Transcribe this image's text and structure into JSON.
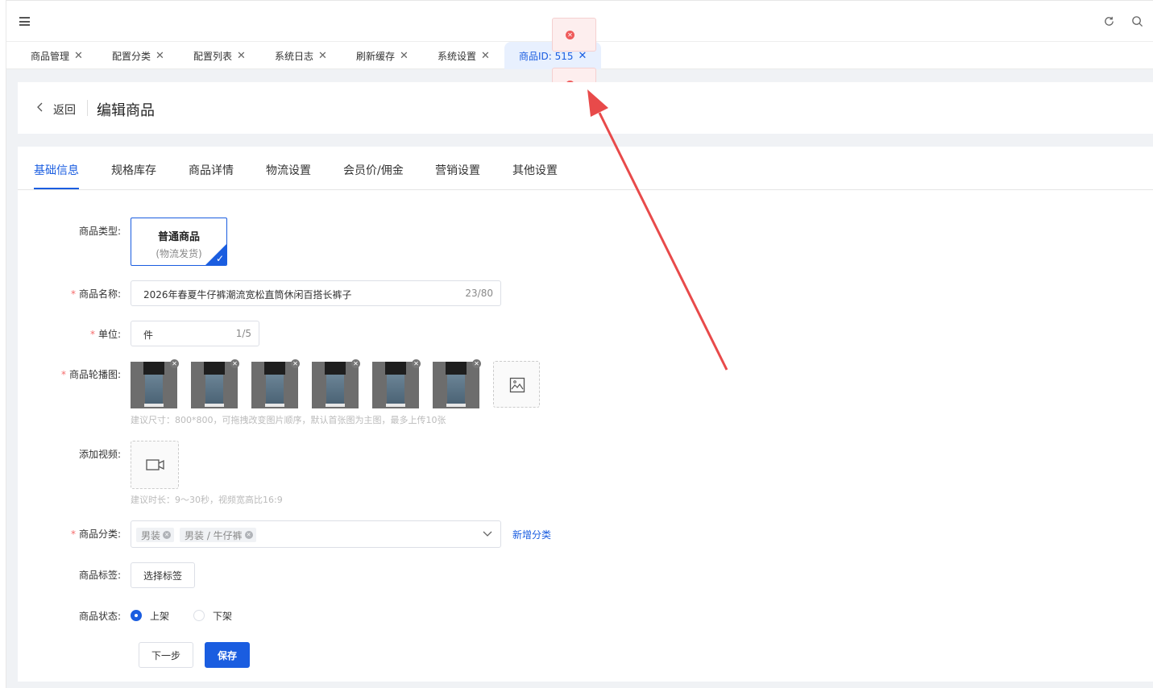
{
  "tabs": [
    {
      "label": "商品管理"
    },
    {
      "label": "配置分类"
    },
    {
      "label": "配置列表"
    },
    {
      "label": "系统日志"
    },
    {
      "label": "刷新缓存"
    },
    {
      "label": "系统设置"
    },
    {
      "label": "商品ID: 515"
    }
  ],
  "header": {
    "back_label": "返回",
    "title": "编辑商品"
  },
  "subtabs": [
    "基础信息",
    "规格库存",
    "商品详情",
    "物流设置",
    "会员价/佣金",
    "营销设置",
    "其他设置"
  ],
  "form": {
    "type_label": "商品类型:",
    "type_option_title": "普通商品",
    "type_option_sub": "(物流发货)",
    "name_label": "商品名称:",
    "name_value": "2026年春夏牛仔裤潮流宽松直筒休闲百搭长裤子",
    "name_count": "23/80",
    "unit_label": "单位:",
    "unit_value": "件",
    "unit_count": "1/5",
    "carousel_label": "商品轮播图:",
    "carousel_hint": "建议尺寸：800*800，可拖拽改变图片顺序，默认首张图为主图，最多上传10张",
    "video_label": "添加视频:",
    "video_hint": "建议时长：9～30秒，视频宽高比16:9",
    "category_label": "商品分类:",
    "category_tags": [
      "男装",
      "男装 / 牛仔裤"
    ],
    "add_category": "新增分类",
    "tag_label": "商品标签:",
    "choose_tag": "选择标签",
    "status_label": "商品状态:",
    "status_on": "上架",
    "status_off": "下架",
    "next_btn": "下一步",
    "save_btn": "保存"
  },
  "colors": {
    "primary": "#1a5de0",
    "error": "#ef5b5b",
    "annotation": "#e84a4a"
  }
}
